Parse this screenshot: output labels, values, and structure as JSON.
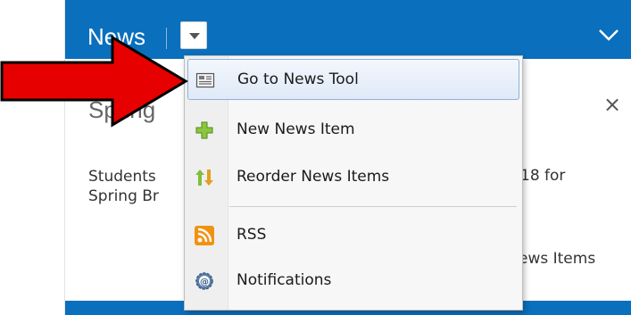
{
  "header": {
    "title": "News"
  },
  "content": {
    "title_partial": "Spring",
    "text_line1_start": "Students",
    "text_line1_end": "18 for",
    "text_line2_start": "Spring Br",
    "view_all_partial": "ews Items",
    "close_symbol": "×"
  },
  "menu": {
    "items": [
      {
        "label": "Go to News Tool",
        "icon": "news-tool-icon"
      },
      {
        "label": "New News Item",
        "icon": "plus-icon"
      },
      {
        "label": "Reorder News Items",
        "icon": "reorder-icon"
      },
      {
        "label": "RSS",
        "icon": "rss-icon"
      },
      {
        "label": "Notifications",
        "icon": "notifications-gear-icon"
      }
    ]
  },
  "colors": {
    "header_bg": "#0a6fbd",
    "arrow": "#e60000",
    "highlight_border": "#8fb2dc"
  }
}
